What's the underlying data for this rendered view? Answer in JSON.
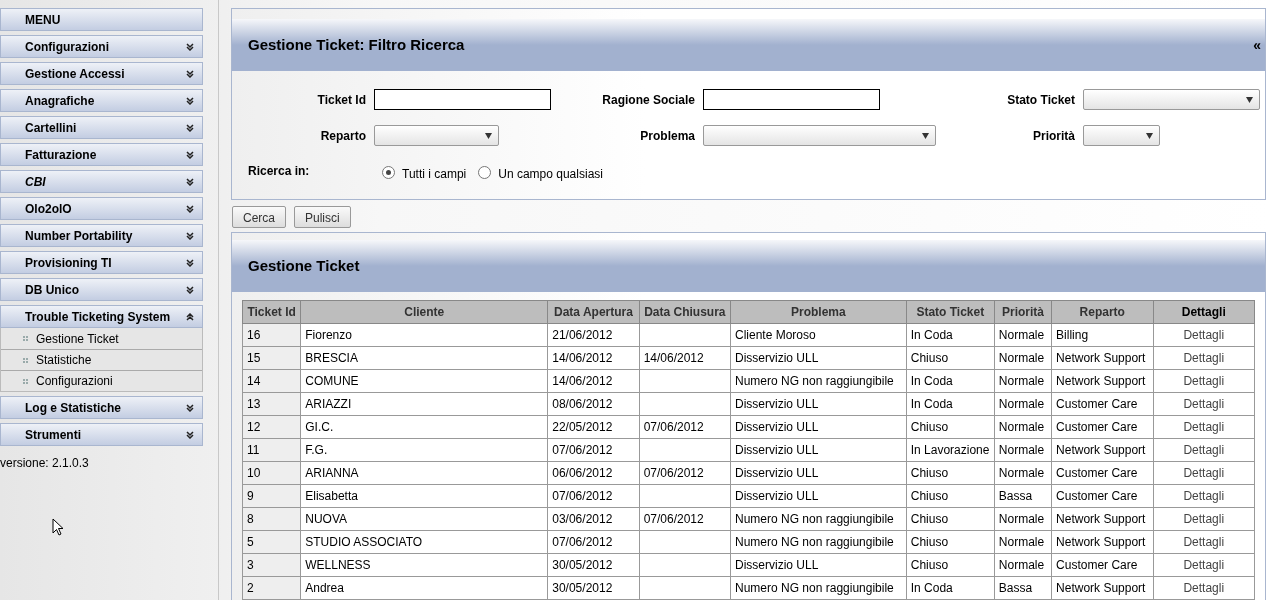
{
  "sidebar": {
    "title": "MENU",
    "items": [
      {
        "label": "Configurazioni",
        "expanded": false,
        "italic": false
      },
      {
        "label": "Gestione Accessi",
        "expanded": false,
        "italic": false
      },
      {
        "label": "Anagrafiche",
        "expanded": false,
        "italic": false
      },
      {
        "label": "Cartellini",
        "expanded": false,
        "italic": false
      },
      {
        "label": "Fatturazione",
        "expanded": false,
        "italic": false
      },
      {
        "label": "CBI",
        "expanded": false,
        "italic": true
      },
      {
        "label": "Olo2olO",
        "expanded": false,
        "italic": false
      },
      {
        "label": "Number Portability",
        "expanded": false,
        "italic": false
      },
      {
        "label": "Provisioning TI",
        "expanded": false,
        "italic": false
      },
      {
        "label": "DB Unico",
        "expanded": false,
        "italic": false
      },
      {
        "label": "Trouble Ticketing System",
        "expanded": true,
        "italic": false,
        "children": [
          {
            "label": "Gestione Ticket"
          },
          {
            "label": "Statistiche"
          },
          {
            "label": "Configurazioni"
          }
        ]
      },
      {
        "label": "Log e Statistiche",
        "expanded": false,
        "italic": false
      },
      {
        "label": "Strumenti",
        "expanded": false,
        "italic": false
      }
    ],
    "version": "versione: 2.1.0.3"
  },
  "filter_panel": {
    "title": "Gestione Ticket: Filtro Ricerca",
    "collapse_glyph": "«",
    "fields": [
      {
        "kind": "text",
        "label": "Ticket Id"
      },
      {
        "kind": "text",
        "label": "Ragione Sociale"
      },
      {
        "kind": "select",
        "label": "Stato Ticket"
      },
      {
        "kind": "select",
        "label": "Reparto"
      },
      {
        "kind": "select",
        "label": "Problema"
      },
      {
        "kind": "select",
        "label": "Priorità"
      }
    ],
    "search_in": {
      "label": "Ricerca in:",
      "options": [
        {
          "label": "Tutti i campi",
          "selected": true
        },
        {
          "label": "Un campo qualsiasi",
          "selected": false
        }
      ]
    }
  },
  "buttons": [
    "Cerca",
    "Pulisci"
  ],
  "results_panel": {
    "title": "Gestione Ticket"
  },
  "table": {
    "columns": [
      "Ticket Id",
      "Cliente",
      "Data Apertura",
      "Data Chiusura",
      "Problema",
      "Stato Ticket",
      "Priorità",
      "Reparto",
      "Dettagli"
    ],
    "rows": [
      [
        "16",
        "Fiorenzo",
        "21/06/2012",
        "",
        "Cliente Moroso",
        "In Coda",
        "Normale",
        "Billing",
        "Dettagli"
      ],
      [
        "15",
        "BRESCIA",
        "14/06/2012",
        "14/06/2012",
        "Disservizio ULL",
        "Chiuso",
        "Normale",
        "Network Support",
        "Dettagli"
      ],
      [
        "14",
        "COMUNE",
        "14/06/2012",
        "",
        "Numero NG non raggiungibile",
        "In Coda",
        "Normale",
        "Network Support",
        "Dettagli"
      ],
      [
        "13",
        "ARIAZZI",
        "08/06/2012",
        "",
        "Disservizio ULL",
        "In Coda",
        "Normale",
        "Customer Care",
        "Dettagli"
      ],
      [
        "12",
        "GI.C.",
        "22/05/2012",
        "07/06/2012",
        "Disservizio ULL",
        "Chiuso",
        "Normale",
        "Customer Care",
        "Dettagli"
      ],
      [
        "11",
        "F.G.",
        "07/06/2012",
        "",
        "Disservizio ULL",
        "In Lavorazione",
        "Normale",
        "Network Support",
        "Dettagli"
      ],
      [
        "10",
        "ARIANNA",
        "06/06/2012",
        "07/06/2012",
        "Disservizio ULL",
        "Chiuso",
        "Normale",
        "Customer Care",
        "Dettagli"
      ],
      [
        "9",
        "Elisabetta",
        "07/06/2012",
        "",
        "Disservizio ULL",
        "Chiuso",
        "Bassa",
        "Customer Care",
        "Dettagli"
      ],
      [
        "8",
        "NUOVA",
        "03/06/2012",
        "07/06/2012",
        "Numero NG non raggiungibile",
        "Chiuso",
        "Normale",
        "Network Support",
        "Dettagli"
      ],
      [
        "5",
        "STUDIO ASSOCIATO",
        "07/06/2012",
        "",
        "Numero NG non raggiungibile",
        "Chiuso",
        "Normale",
        "Network Support",
        "Dettagli"
      ],
      [
        "3",
        "WELLNESS",
        "30/05/2012",
        "",
        "Disservizio ULL",
        "Chiuso",
        "Normale",
        "Customer Care",
        "Dettagli"
      ],
      [
        "2",
        "Andrea",
        "30/05/2012",
        "",
        "Numero NG non raggiungibile",
        "In Coda",
        "Bassa",
        "Network Support",
        "Dettagli"
      ]
    ]
  }
}
